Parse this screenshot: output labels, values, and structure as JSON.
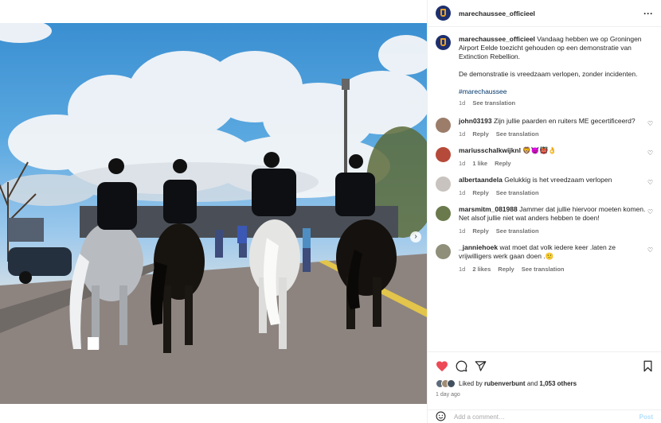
{
  "post": {
    "username": "marechaussee_officieel",
    "caption_lines": [
      "Vandaag hebben we op Groningen Airport Eelde toezicht gehouden op een demonstratie van Extinction Rebellion.",
      "De demonstratie is vreedzaam verlopen, zonder incidenten."
    ],
    "hashtag": "#marechaussee",
    "time": "1d",
    "see_translation": "See translation"
  },
  "comments": [
    {
      "user": "john03193",
      "text": "Zijn jullie paarden en ruiters ME gecertificeerd?",
      "time": "1d",
      "actions": [
        "Reply",
        "See translation"
      ],
      "avatar_color": "#9b7d6a"
    },
    {
      "user": "mariusschalkwijknl",
      "text": "🦁😈👹👌",
      "time": "1d",
      "actions": [
        "1 like",
        "Reply"
      ],
      "avatar_color": "#b64a3a"
    },
    {
      "user": "albertaandela",
      "text": "Gelukkig is het vreedzaam verlopen",
      "time": "1d",
      "actions": [
        "Reply",
        "See translation"
      ],
      "avatar_color": "#c8c3be"
    },
    {
      "user": "marsmitm_081988",
      "text": "Jammer dat jullie hiervoor moeten komen. Net alsof jullie niet wat anders hebben te doen!",
      "time": "1d",
      "actions": [
        "Reply",
        "See translation"
      ],
      "avatar_color": "#6b7a4c"
    },
    {
      "user": "_janniehoek",
      "text": "wat moet dat volk iedere keer .laten ze vrijwilligers werk gaan doen .🙂",
      "time": "1d",
      "actions": [
        "2 likes",
        "Reply",
        "See translation"
      ],
      "avatar_color": "#8f8f7a"
    }
  ],
  "likes": {
    "prefix": "Liked by",
    "user": "rubenverbunt",
    "middle": "and",
    "count": "1,053 others",
    "avatar_colors": [
      "#5e6b7a",
      "#a08b73",
      "#42505e"
    ]
  },
  "posted_ago": "1 day ago",
  "add_comment": {
    "placeholder": "Add a comment…",
    "post_label": "Post"
  },
  "icons": {
    "like": "heart-filled-icon",
    "comment": "comment-icon",
    "share": "share-icon",
    "save": "bookmark-icon",
    "more": "more-icon",
    "emoji": "emoji-icon",
    "next": "chevron-right-icon"
  },
  "colors": {
    "like": "#ed4956",
    "link": "#00376b",
    "muted": "#737373",
    "post_disabled": "#b2dffc",
    "brand_navy": "#1d2f6f",
    "brand_orange": "#e8a126"
  }
}
